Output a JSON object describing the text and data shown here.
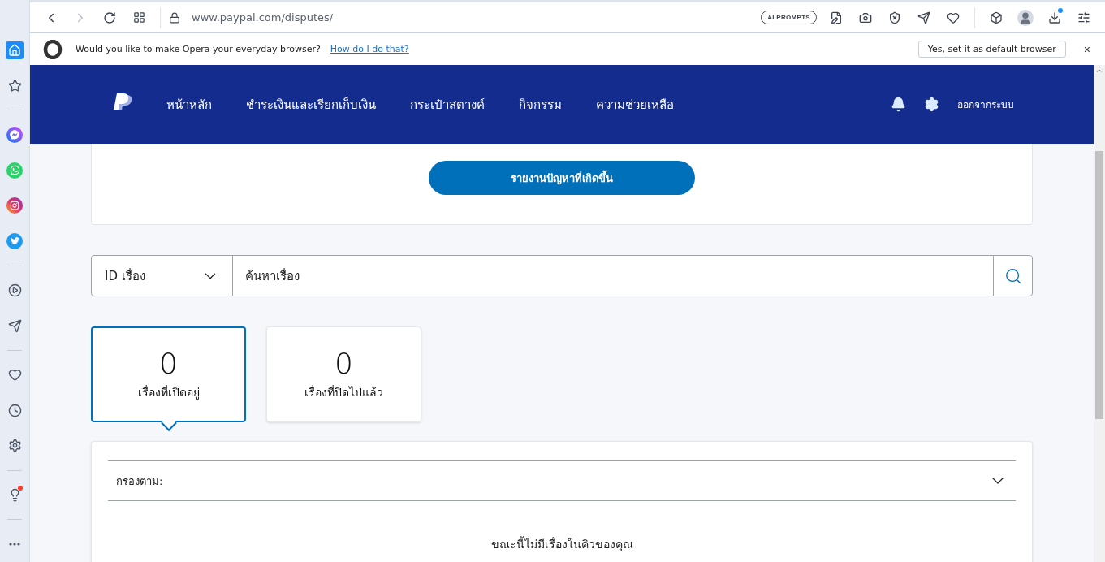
{
  "browser": {
    "url": "www.paypal.com/disputes/",
    "ai_prompts": "AI PROMPTS"
  },
  "sidebar": [
    {
      "kind": "home",
      "selected": true,
      "notification": false
    },
    {
      "kind": "star",
      "selected": false,
      "notification": false
    },
    {
      "kind": "divider"
    },
    {
      "kind": "messenger",
      "selected": false,
      "notification": false
    },
    {
      "kind": "whatsapp",
      "selected": false,
      "notification": false
    },
    {
      "kind": "instagram",
      "selected": false,
      "notification": false
    },
    {
      "kind": "twitter",
      "selected": false,
      "notification": false
    },
    {
      "kind": "divider"
    },
    {
      "kind": "player",
      "selected": false,
      "notification": false
    },
    {
      "kind": "send",
      "selected": false,
      "notification": false
    },
    {
      "kind": "divider"
    },
    {
      "kind": "heart",
      "selected": false,
      "notification": false
    },
    {
      "kind": "history",
      "selected": false,
      "notification": false
    },
    {
      "kind": "settings",
      "selected": false,
      "notification": false
    },
    {
      "kind": "divider"
    },
    {
      "kind": "tips",
      "selected": false,
      "notification": true
    },
    {
      "kind": "divider"
    },
    {
      "kind": "more",
      "selected": false,
      "notification": false
    }
  ],
  "infobar": {
    "message": "Would you like to make Opera your everyday browser?",
    "link": "How do I do that?",
    "button": "Yes, set it as default browser",
    "close": "×"
  },
  "header": {
    "nav": [
      "หน้าหลัก",
      "ชำระเงินและเรียกเก็บเงิน",
      "กระเป๋าสตางค์",
      "กิจกรรม",
      "ความช่วยเหลือ"
    ],
    "logout": "ออกจากระบบ"
  },
  "report_button": "รายงานปัญหาที่เกิดขึ้น",
  "search": {
    "select": "ID เรื่อง",
    "placeholder": "ค้นหาเรื่อง"
  },
  "tabs": [
    {
      "count": "0",
      "label": "เรื่องที่เปิดอยู่",
      "selected": true
    },
    {
      "count": "0",
      "label": "เรื่องที่ปิดไปแล้ว",
      "selected": false
    }
  ],
  "filter": {
    "label": "กรองตาม:",
    "expanded": false
  },
  "empty_message": "ขณะนี้ไม่มีเรื่องในคิวของคุณ"
}
